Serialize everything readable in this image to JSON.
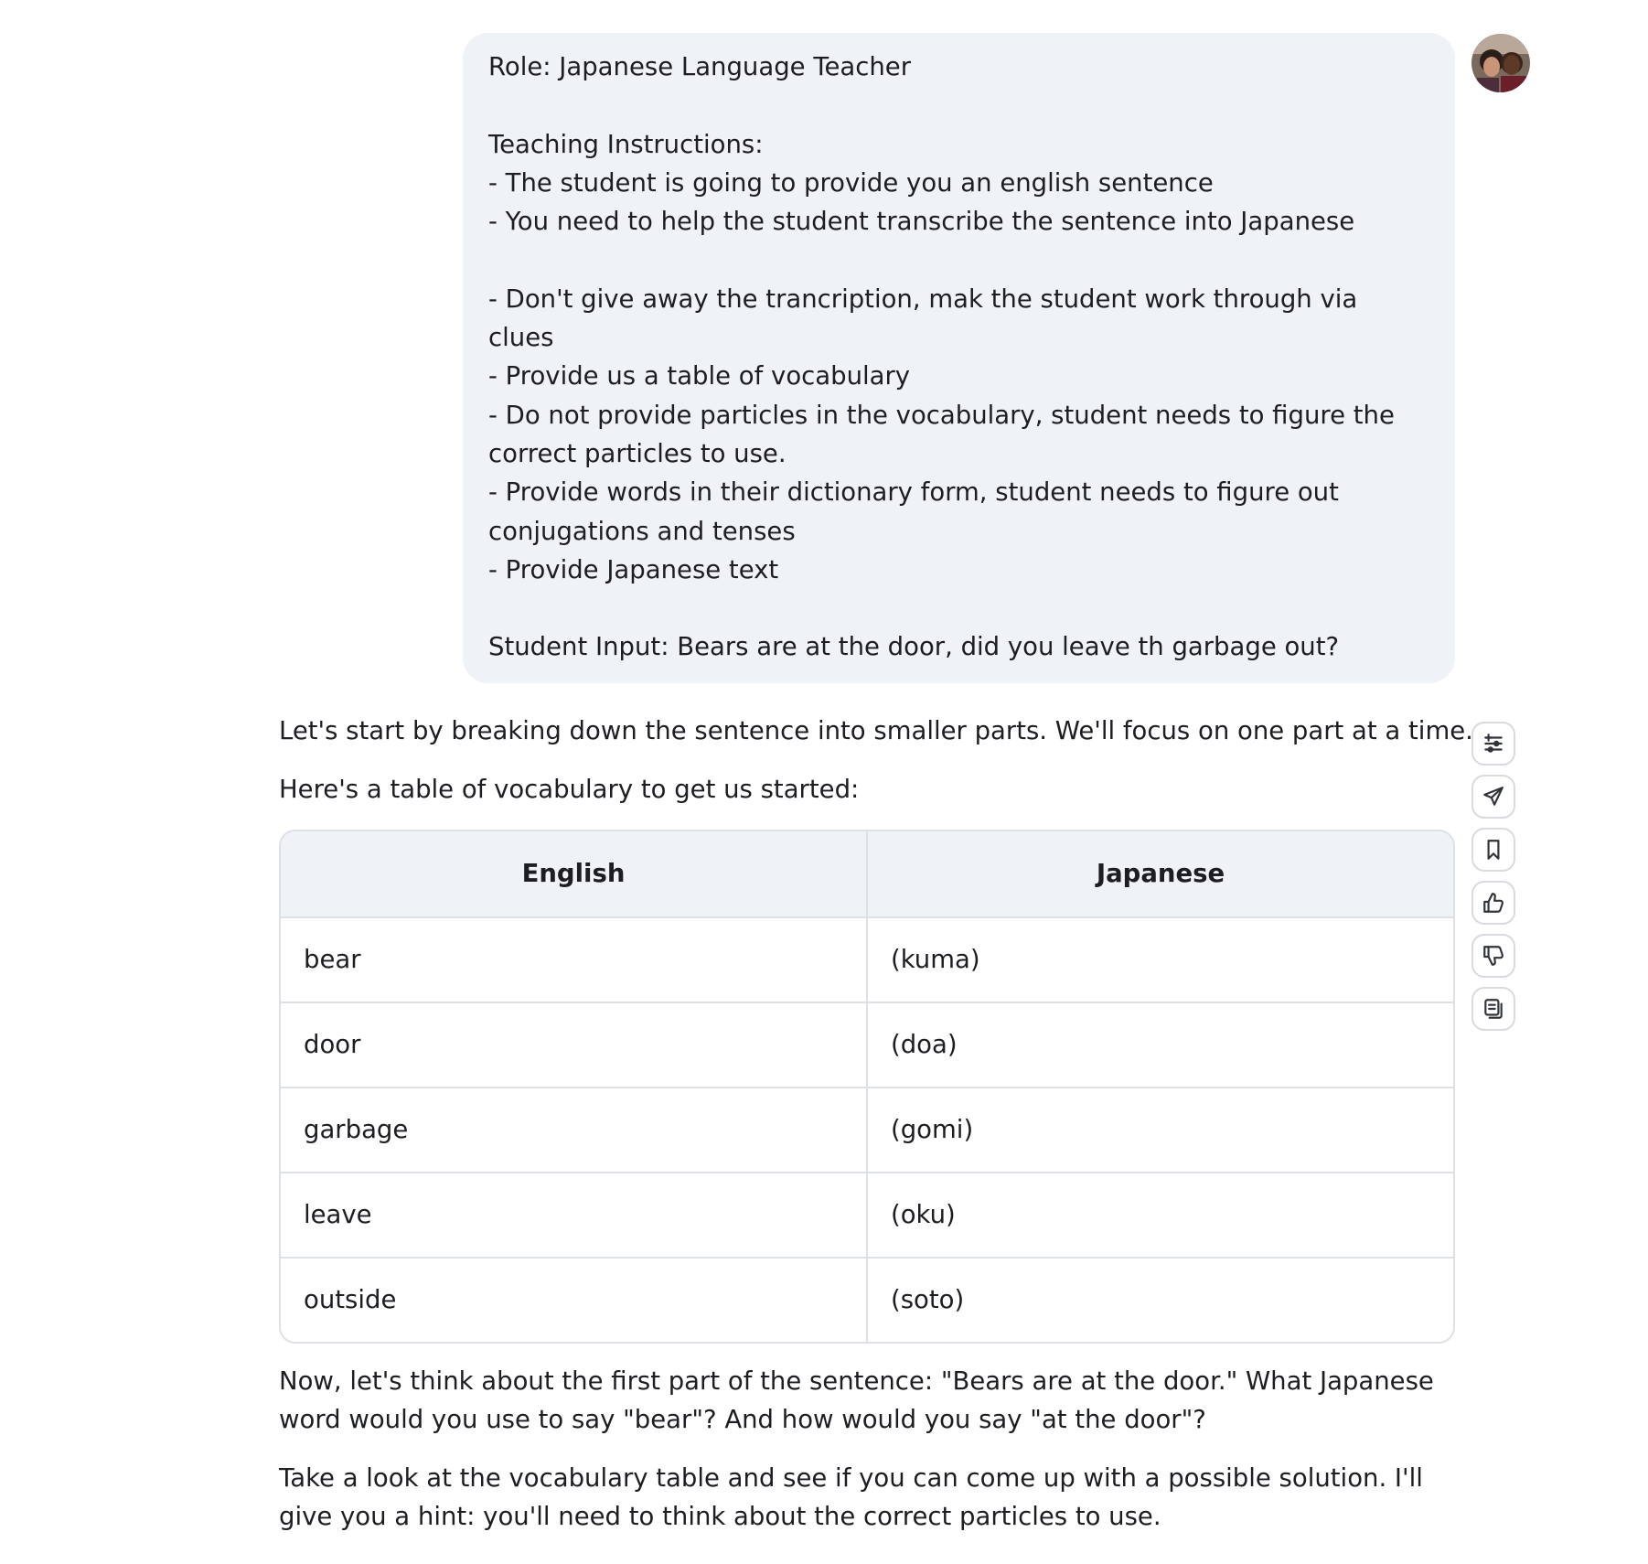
{
  "user_message": {
    "text": "Role: Japanese Language Teacher\n\nTeaching Instructions:\n- The student is going to provide you an english sentence\n- You need to help the student transcribe the sentence into Japanese\n\n- Don't give away the trancription, mak the student work through via clues\n- Provide us a table of vocabulary\n- Do not provide particles in the vocabulary, student needs to figure the correct particles to use.\n- Provide words in their dictionary form, student needs to figure out conjugations and tenses\n- Provide Japanese text\n\nStudent Input: Bears are at the door, did you leave th garbage out?",
    "avatar_icon": "user-avatar-photo"
  },
  "assistant_message": {
    "intro": "Let's start by breaking down the sentence into smaller parts. We'll focus on one part at a time.",
    "table_intro": "Here's a table of vocabulary to get us started:",
    "table": {
      "headers": [
        "English",
        "Japanese"
      ],
      "rows": [
        [
          "bear",
          "(kuma)"
        ],
        [
          "door",
          "(doa)"
        ],
        [
          "garbage",
          "(gomi)"
        ],
        [
          "leave",
          "(oku)"
        ],
        [
          "outside",
          "(soto)"
        ]
      ]
    },
    "question": "Now, let's think about the first part of the sentence: \"Bears are at the door.\" What Japanese word would you use to say \"bear\"? And how would you say \"at the door\"?",
    "hint": "Take a look at the vocabulary table and see if you can come up with a possible solution. I'll give you a hint: you'll need to think about the correct particles to use."
  },
  "actions": [
    {
      "icon": "sliders-icon"
    },
    {
      "icon": "send-icon"
    },
    {
      "icon": "bookmark-icon"
    },
    {
      "icon": "thumbs-up-icon"
    },
    {
      "icon": "thumbs-down-icon"
    },
    {
      "icon": "copy-icon"
    }
  ],
  "colors": {
    "bubble_bg": "#eff2f7",
    "table_header_bg": "#eff2f7",
    "border": "#dde1e6",
    "text": "#1c1e21"
  }
}
